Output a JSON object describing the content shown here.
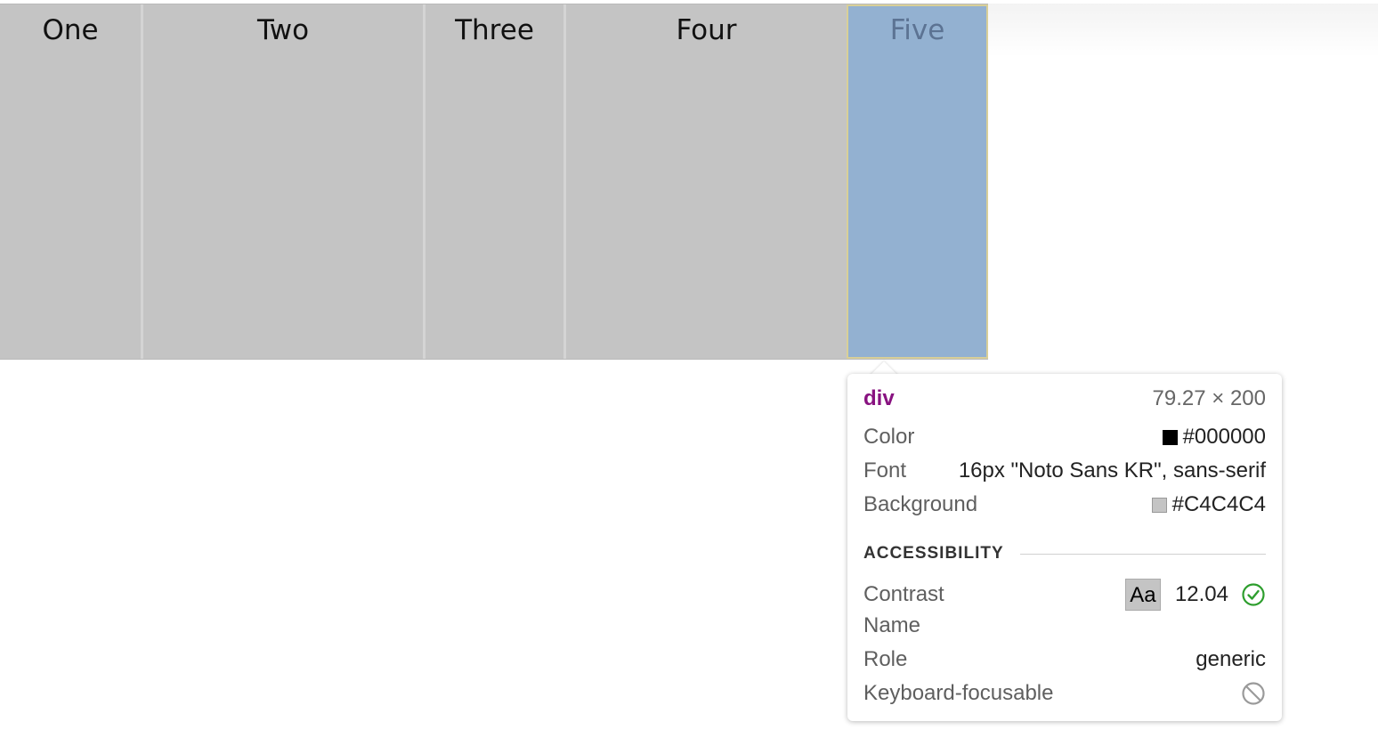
{
  "flex_items": [
    {
      "label": "One"
    },
    {
      "label": "Two"
    },
    {
      "label": "Three"
    },
    {
      "label": "Four"
    },
    {
      "label": "Five"
    }
  ],
  "tooltip": {
    "tag": "div",
    "dimensions": "79.27 × 200",
    "color_label": "Color",
    "color_value": "#000000",
    "font_label": "Font",
    "font_value": "16px \"Noto Sans KR\", sans-serif",
    "background_label": "Background",
    "background_value": "#C4C4C4",
    "accessibility_heading": "ACCESSIBILITY",
    "contrast_label": "Contrast",
    "contrast_sample": "Aa",
    "contrast_value": "12.04",
    "name_label": "Name",
    "name_value": "",
    "role_label": "Role",
    "role_value": "generic",
    "keyboard_label": "Keyboard-focusable"
  },
  "colors": {
    "item_background": "#C4C4C4",
    "highlight_background": "#93B1D1",
    "tag_color": "#881280",
    "pass_green": "#2E9E2E"
  },
  "icons": {
    "contrast_status": "check-circle-icon",
    "keyboard_status": "not-allowed-icon"
  }
}
